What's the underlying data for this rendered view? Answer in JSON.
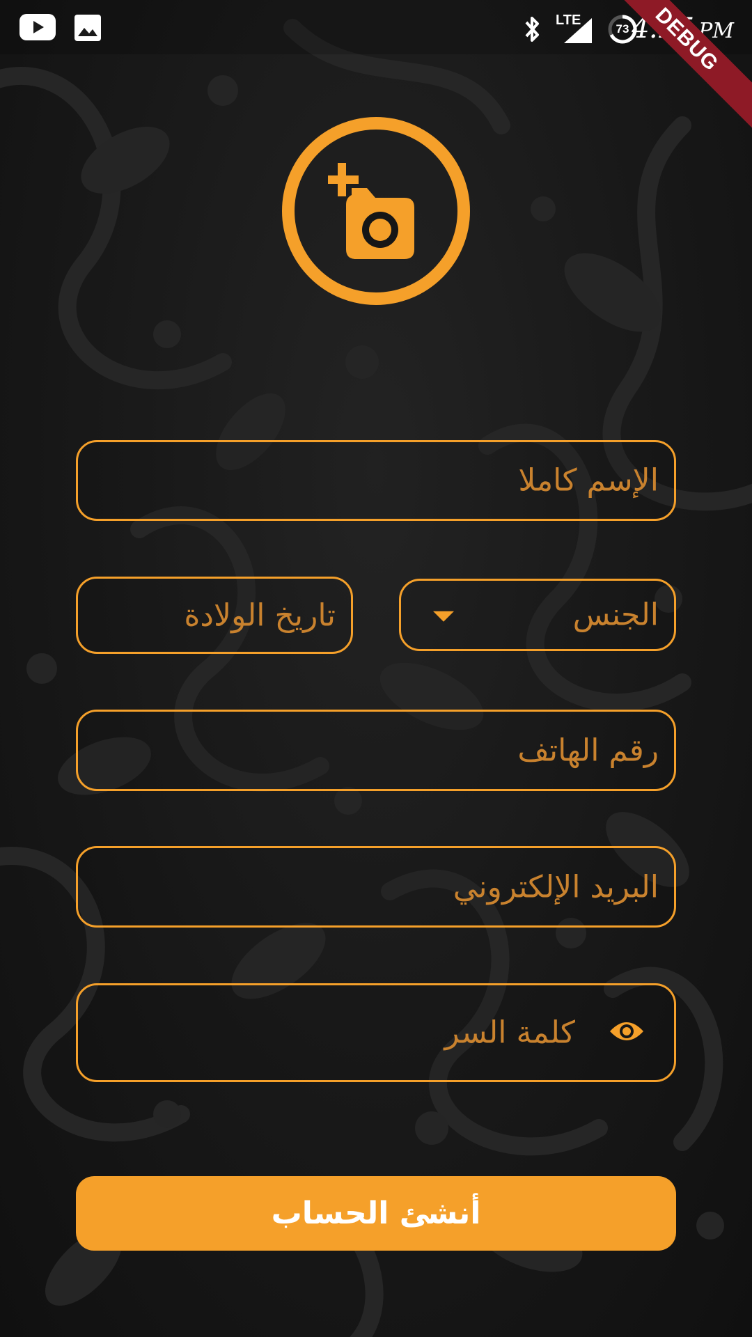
{
  "status_bar": {
    "left_icons": [
      "youtube-icon",
      "image-icon"
    ],
    "network": "LTE",
    "battery_level": "73",
    "time": "4:25",
    "ampm": "PM",
    "debug_label": "DEBUG"
  },
  "avatar": {
    "icon": "add-a-photo-icon"
  },
  "form": {
    "full_name_placeholder": "الإسم كاملا",
    "gender_placeholder": "الجنس",
    "birth_date_placeholder": "تاريخ الولادة",
    "phone_placeholder": "رقم الهاتف",
    "email_placeholder": "البريد الإلكتروني",
    "password_placeholder": "كلمة السر",
    "password_toggle_icon": "eye-icon"
  },
  "actions": {
    "create_account_label": "أنشئ الحساب"
  },
  "colors": {
    "accent": "#f5a02a",
    "background": "#181818",
    "debug_ribbon": "#8e1a26"
  }
}
